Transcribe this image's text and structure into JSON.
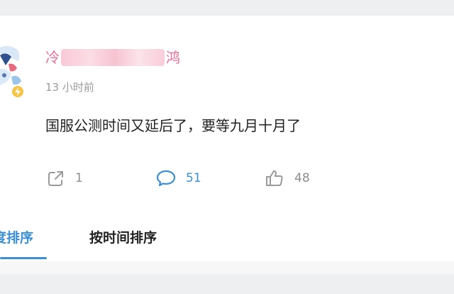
{
  "post": {
    "username_visible_start": "冷",
    "username_visible_end": "鸿",
    "timestamp": "13 小时前",
    "content": "国服公测时间又延后了，要等九月十月了",
    "actions": {
      "share_count": "1",
      "comment_count": "51",
      "like_count": "48"
    },
    "colors": {
      "username": "#ec6c93",
      "accent": "#3b8fd5",
      "badge": "#f6c548"
    }
  },
  "tabs": [
    {
      "label": "热度排序",
      "visible_label": "度排序",
      "active": true
    },
    {
      "label": "按时间排序",
      "active": false
    }
  ]
}
